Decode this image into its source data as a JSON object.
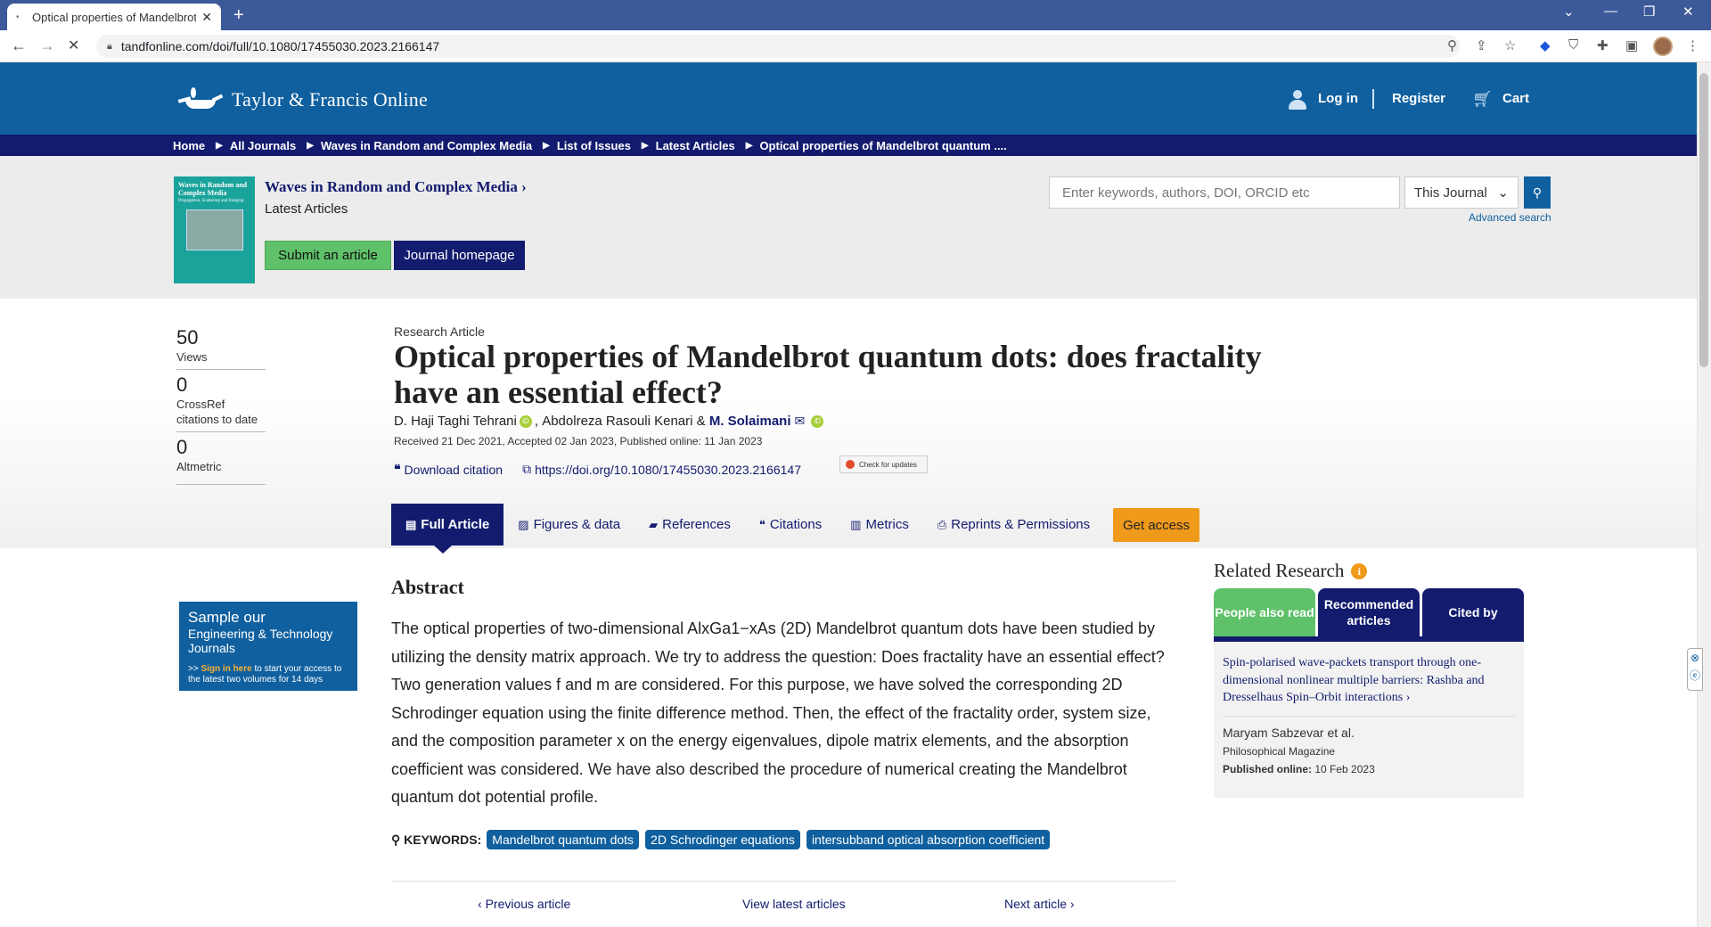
{
  "browser": {
    "tab_title": "Optical properties of Mandelbrot",
    "url": "tandfonline.com/doi/full/10.1080/17455030.2023.2166147"
  },
  "header": {
    "logo_text": "Taylor & Francis Online",
    "login": "Log in",
    "register": "Register",
    "cart": "Cart"
  },
  "breadcrumb": [
    "Home",
    "All Journals",
    "Waves in Random and Complex Media",
    "List of Issues",
    "Latest Articles",
    "Optical properties of Mandelbrot quantum ...."
  ],
  "journal": {
    "cover_title": "Waves in Random and Complex Media",
    "cover_sub": "Propagation, Scattering and Imaging",
    "title": "Waves in Random and Complex Media",
    "subtitle": "Latest Articles",
    "submit_label": "Submit an article",
    "homepage_label": "Journal homepage"
  },
  "search": {
    "placeholder": "Enter keywords, authors, DOI, ORCID etc",
    "scope": "This Journal",
    "advanced": "Advanced search"
  },
  "metrics": [
    {
      "num": "50",
      "label": "Views"
    },
    {
      "num": "0",
      "label": "CrossRef citations to date"
    },
    {
      "num": "0",
      "label": "Altmetric"
    }
  ],
  "article": {
    "type": "Research Article",
    "title": "Optical properties of Mandelbrot quantum dots: does fractality have an essential effect?",
    "authors": [
      "D. Haji Taghi Tehrani",
      "Abdolreza Rasouli Kenari",
      "M. Solaimani"
    ],
    "dates": "Received 21 Dec 2021, Accepted 02 Jan 2023, Published online: 11 Jan 2023",
    "download_citation": "Download citation",
    "doi": "https://doi.org/10.1080/17455030.2023.2166147",
    "check_updates": "Check for updates"
  },
  "tabs": [
    "Full Article",
    "Figures & data",
    "References",
    "Citations",
    "Metrics",
    "Reprints & Permissions"
  ],
  "get_access": "Get access",
  "abstract": {
    "heading": "Abstract",
    "text": "The optical properties of two-dimensional AlxGa1−xAs (2D) Mandelbrot quantum dots have been studied by utilizing the density matrix approach. We try to address the question: Does fractality have an essential effect? Two generation values f and m are considered. For this purpose, we have solved the corresponding 2D Schrodinger equation using the finite difference method. Then, the effect of the fractality order, system size, and the composition parameter x on the energy eigenvalues, dipole matrix elements, and the absorption coefficient was considered. We have also described the procedure of numerical creating the Mandelbrot quantum dot potential profile."
  },
  "keywords": {
    "label": "KEYWORDS:",
    "items": [
      "Mandelbrot quantum dots",
      "2D Schrodinger equations",
      "intersubband optical absorption coefficient"
    ]
  },
  "pager": {
    "previous": "Previous article",
    "latest": "View latest articles",
    "next": "Next article"
  },
  "sample_ad": {
    "line1": "Sample our",
    "line2": "Engineering & Technology Journals",
    "signin": "Sign in here",
    "line3": "to start your access to the latest two volumes for 14 days"
  },
  "related": {
    "title": "Related Research",
    "tabs": [
      "People also read",
      "Recommended articles",
      "Cited by"
    ],
    "card": {
      "title": "Spin-polarised wave-packets transport through one-dimensional nonlinear multiple barriers: Rashba and Dresselhaus Spin–Orbit interactions",
      "authors": "Maryam Sabzevar et al.",
      "journal": "Philosophical Magazine",
      "published_label": "Published online:",
      "published_date": "10 Feb 2023"
    }
  },
  "colors": {
    "brand_blue": "#10609f",
    "navy": "#121b6e",
    "green": "#5fc16a",
    "orange": "#f09a1c"
  }
}
